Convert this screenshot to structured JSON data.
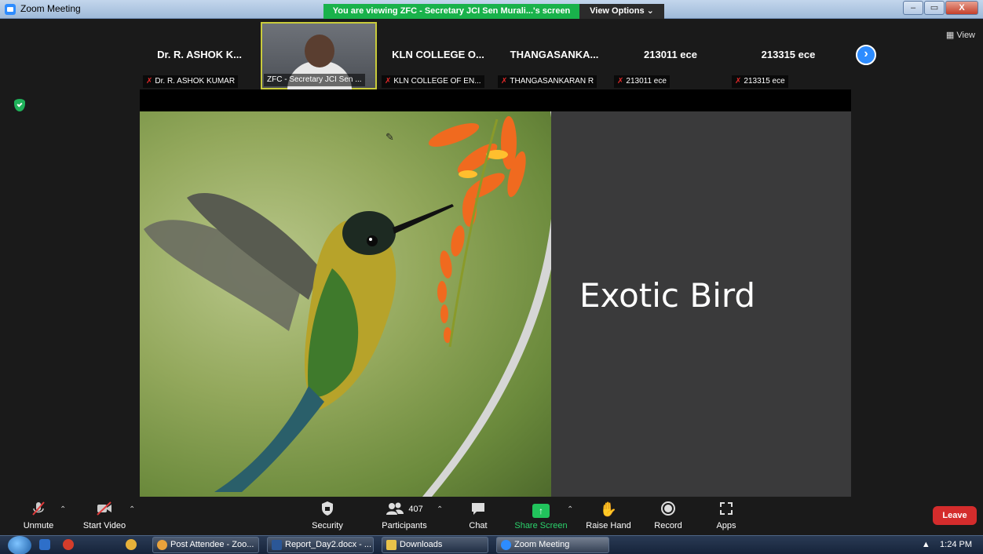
{
  "window": {
    "title": "Zoom Meeting",
    "banner": "You are viewing ZFC - Secretary JCI Sen Murali...'s screen",
    "view_options": "View Options ⌄",
    "minimize": "–",
    "maximize": "▭",
    "close": "X"
  },
  "strip": {
    "tiles": [
      {
        "big_name": "Dr. R. ASHOK K...",
        "label": "Dr. R. ASHOK KUMAR",
        "muted": true
      },
      {
        "big_name": "",
        "label": "ZFC - Secretary JCI Sen ...",
        "muted": false,
        "active": true
      },
      {
        "big_name": "KLN COLLEGE O...",
        "label": "KLN COLLEGE OF EN...",
        "muted": true
      },
      {
        "big_name": "THANGASANKA...",
        "label": "THANGASANKARAN R",
        "muted": true
      },
      {
        "big_name": "213011 ece",
        "label": "213011 ece",
        "muted": true
      },
      {
        "big_name": "213315 ece",
        "label": "213315 ece",
        "muted": true
      }
    ],
    "next_symbol": "›",
    "mute_symbol": "✗"
  },
  "view_button": "▦ View",
  "slide": {
    "title": "Exotic Bird"
  },
  "toolbar": {
    "unmute": "Unmute",
    "start_video": "Start Video",
    "security": "Security",
    "participants": "Participants",
    "participants_count": "407",
    "chat": "Chat",
    "share_screen": "Share Screen",
    "raise_hand": "Raise Hand",
    "record": "Record",
    "apps": "Apps",
    "leave": "Leave"
  },
  "taskbar": {
    "items": [
      {
        "label": "Post Attendee - Zoo...",
        "color": "#e9a23b"
      },
      {
        "label": "Report_Day2.docx - ...",
        "color": "#2b5797"
      },
      {
        "label": "Downloads",
        "color": "#e8c34a"
      },
      {
        "label": "Zoom Meeting",
        "color": "#2d8cff"
      }
    ],
    "time": "1:24 PM",
    "tray_arrow": "▲"
  },
  "colors": {
    "accent": "#2d8cff",
    "banner_green": "#19b24b",
    "leave_red": "#d42c2c"
  }
}
